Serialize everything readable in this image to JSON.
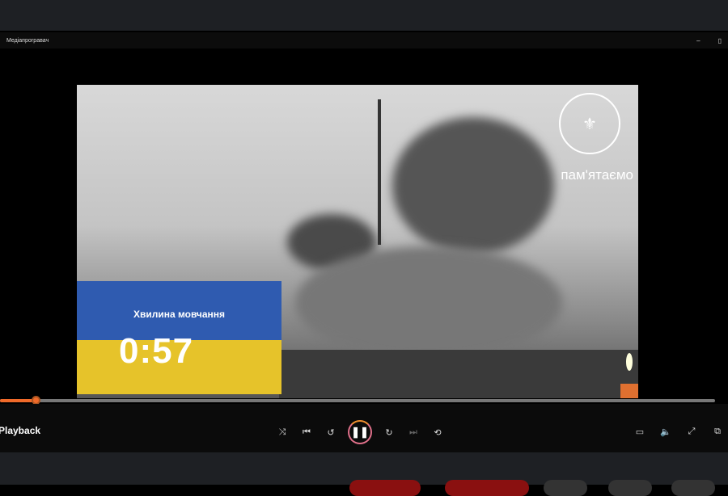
{
  "window": {
    "title": "Медіапрогравач",
    "minimize": "–",
    "restore": "▯"
  },
  "video": {
    "overlay_title": "Хвилина мовчання",
    "timer": "0:57",
    "watermark": "пам'ятаємо",
    "logo_icon": "emblem-icon"
  },
  "playback": {
    "label": "Playback",
    "progress_percent": 5,
    "state": "playing"
  },
  "controls": {
    "shuffle": "⤨",
    "previous": "⏮",
    "rewind": "↺",
    "pause": "❚❚",
    "forward": "↻",
    "next": "⏭",
    "repeat": "⟲"
  },
  "right_controls": {
    "miniplayer": "▭",
    "volume": "🔈",
    "fullscreen": "⤢",
    "cast": "⧉"
  },
  "colors": {
    "accent": "#f06a2a",
    "flag_blue": "#2f5bb0",
    "flag_yellow": "#e6c32a"
  }
}
